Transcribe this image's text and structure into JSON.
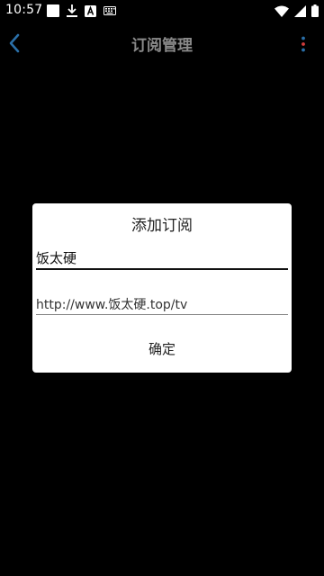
{
  "status_bar": {
    "time": "10:57",
    "icons_left": [
      "square-notification-icon",
      "download-icon",
      "a-font-icon",
      "keyboard-icon"
    ],
    "icons_right": [
      "wifi-icon",
      "cellular-signal-icon",
      "battery-icon"
    ]
  },
  "app_bar": {
    "title": "订阅管理",
    "back_icon": "chevron-left-icon",
    "more_icon": "more-vertical-icon",
    "accent_color": "#2a6fa8",
    "more_dot_colors": [
      "#2a6fa8",
      "#d23c3c",
      "#2a6fa8"
    ]
  },
  "dialog": {
    "title": "添加订阅",
    "name_value": "饭太硬",
    "url_value": "http://www.饭太硬.top/tv",
    "confirm_label": "确定"
  }
}
